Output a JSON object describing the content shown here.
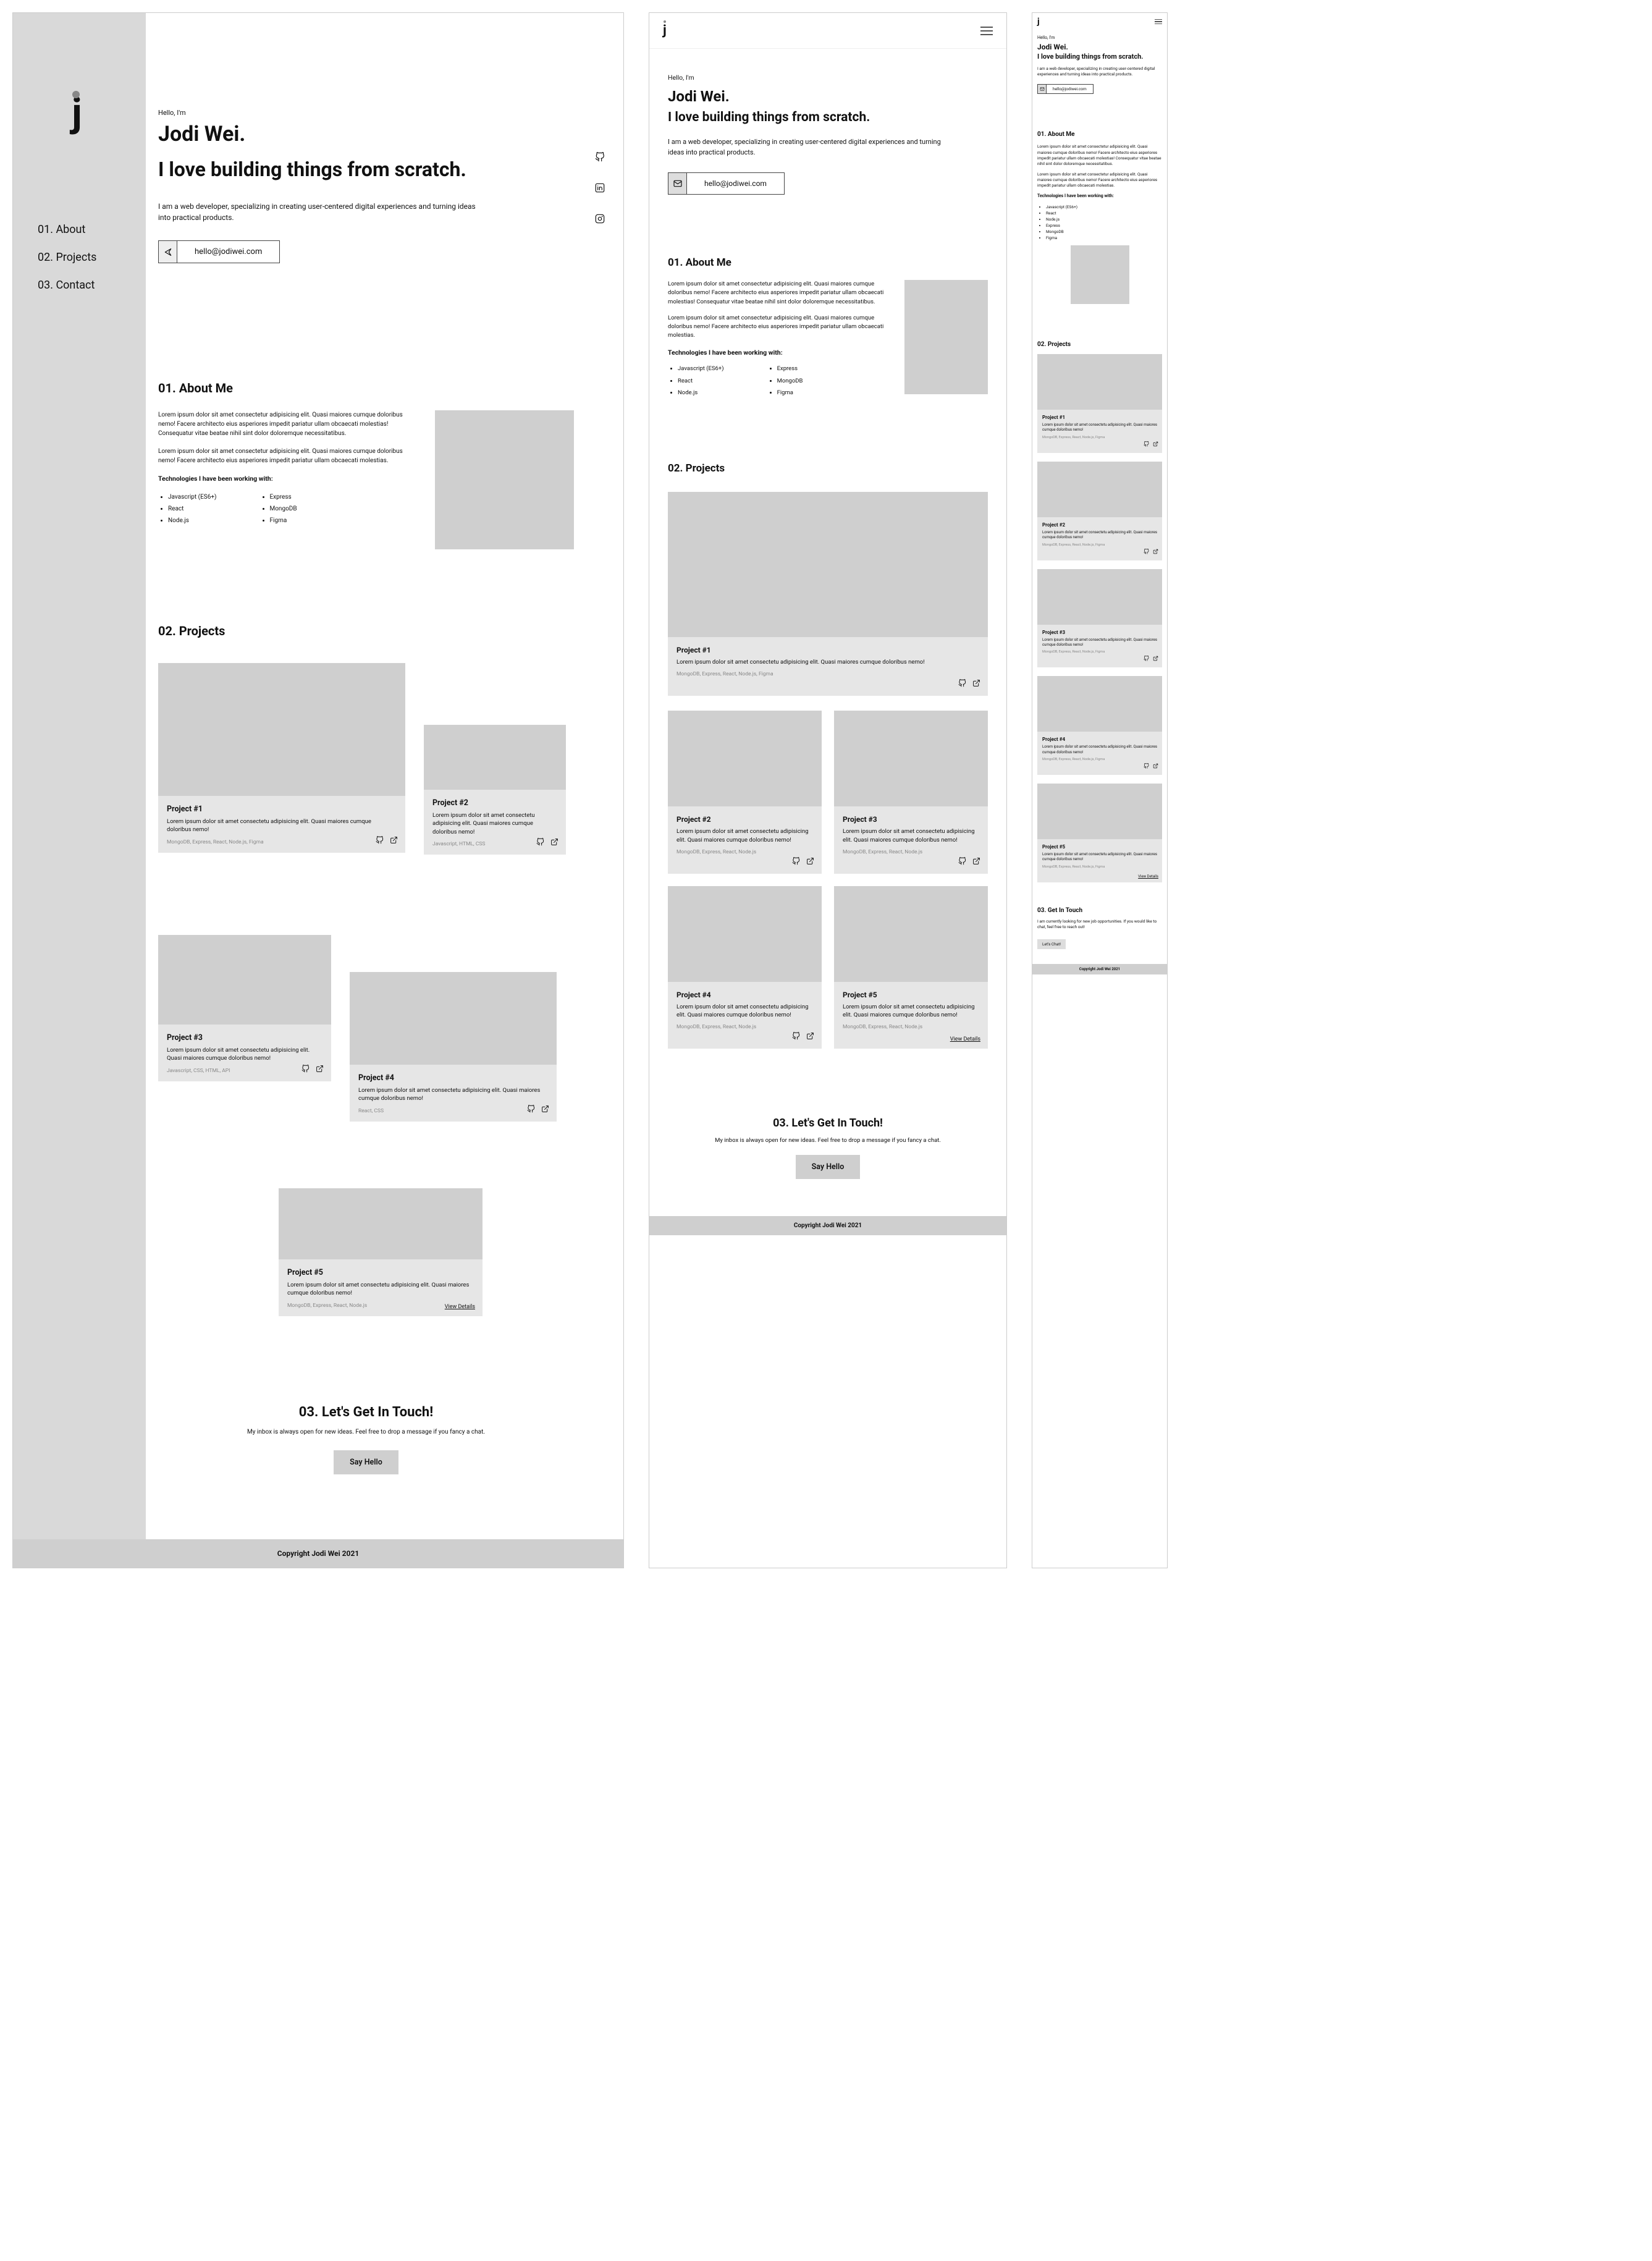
{
  "hero": {
    "greeting": "Hello, I'm",
    "name": "Jodi Wei.",
    "tagline": "I love building things from scratch.",
    "desc_desktop": "I am a web developer, specializing in creating user-centered digital experiences and turning ideas into practical products.",
    "desc_tablet": "I am a web developer, specializing in creating user-centered digital experiences and turning ideas into practical products.",
    "desc_mobile": "I am a web developer, specializing in creating user-centered digital experiences and turning ideas into practical products.",
    "email": "hello@jodiwei.com"
  },
  "nav": {
    "about": "01. About",
    "projects": "02. Projects",
    "contact": "03. Contact"
  },
  "headings": {
    "about": "01. About Me",
    "projects": "02. Projects",
    "contact_desktop": "03. Let's Get In Touch!",
    "contact_mobile": "03. Get In Touch"
  },
  "about": {
    "p1": "Lorem ipsum dolor sit amet consectetur adipisicing elit. Quasi maiores cumque doloribus nemo! Facere architecto eius asperiores impedit pariatur ullam obcaecati molestias! Consequatur vitae beatae nihil sint dolor doloremque necessitatibus.",
    "p2": "Lorem ipsum dolor sit amet consectetur adipisicing elit. Quasi maiores cumque doloribus nemo! Facere architecto eius asperiores impedit pariatur ullam obcaecati molestias.",
    "tech_title": "Technologies I have been working with:"
  },
  "tech": {
    "colA": [
      "Javascript (ES6+)",
      "React",
      "Node.js"
    ],
    "colB": [
      "Express",
      "MongoDB",
      "Figma"
    ]
  },
  "projects": {
    "p1": {
      "title": "Project #1",
      "desc": "Lorem ipsum dolor sit amet consectetu adipisicing elit. Quasi maiores cumque doloribus nemo!",
      "stack": "MongoDB, Express, React, Node.js, Figma"
    },
    "p2": {
      "title": "Project #2",
      "desc": "Lorem ipsum dolor sit amet consectetu adipisicing elit. Quasi maiores cumque doloribus nemo!",
      "stack": "Javascript, HTML, CSS"
    },
    "p3": {
      "title": "Project #3",
      "desc": "Lorem ipsum dolor sit amet consectetu adipisicing elit. Quasi maiores cumque doloribus nemo!",
      "stack": "Javascript, CSS, HTML, API"
    },
    "p4": {
      "title": "Project #4",
      "desc": "Lorem ipsum dolor sit amet consectetu adipisicing elit. Quasi maiores cumque doloribus nemo!",
      "stack": "React, CSS"
    },
    "p5": {
      "title": "Project #5",
      "desc": "Lorem ipsum dolor sit amet consectetu adipisicing elit. Quasi maiores cumque doloribus nemo!",
      "stack": "MongoDB, Express, React, Node.js"
    }
  },
  "t_projects": {
    "stack_generic": "MongoDB, Express, React, Node.js"
  },
  "contact": {
    "blurb": "My inbox is always open for new ideas. Feel free to drop a message if you fancy a chat.",
    "blurb_mobile": "I am currently looking for new job opportunities. If you would like to chat, feel free to reach out!",
    "cta": "Say Hello",
    "cta_mobile": "Let's Chat!",
    "view_details": "View Details"
  },
  "footer": "Copyright Jodi Wei 2021"
}
